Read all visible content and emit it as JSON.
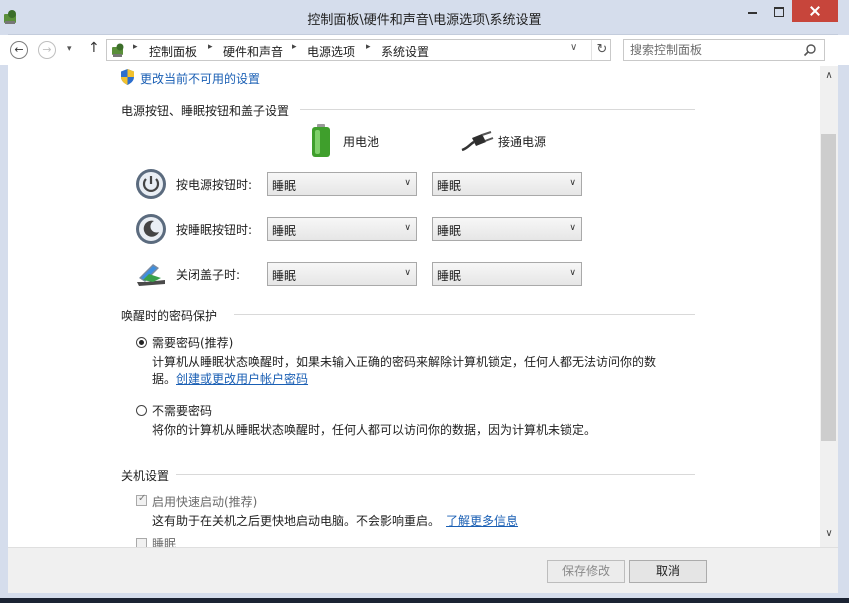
{
  "window": {
    "title": "控制面板\\硬件和声音\\电源选项\\系统设置",
    "minimize_glyph": "",
    "maximize_glyph": "",
    "close_glyph": ""
  },
  "nav": {
    "back_glyph": "←",
    "forward_glyph": "→",
    "history_glyph": "▾",
    "up_glyph": "↑",
    "breadcrumbs": [
      "控制面板",
      "硬件和声音",
      "电源选项",
      "系统设置"
    ],
    "separator_glyph": "▸",
    "dropdown_glyph": "∨",
    "refresh_glyph": "↻",
    "search_placeholder": "搜索控制面板"
  },
  "content": {
    "shield_link": "更改当前不可用的设置",
    "power_section_title": "电源按钮、睡眠按钮和盖子设置",
    "col_battery": "用电池",
    "col_plugged": "接通电源",
    "rows": [
      {
        "label": "按电源按钮时:",
        "battery": "睡眠",
        "plugged": "睡眠"
      },
      {
        "label": "按睡眠按钮时:",
        "battery": "睡眠",
        "plugged": "睡眠"
      },
      {
        "label": "关闭盖子时:",
        "battery": "睡眠",
        "plugged": "睡眠"
      }
    ],
    "select_chevron": "∨",
    "password_section_title": "唤醒时的密码保护",
    "require_password": {
      "label": "需要密码(推荐)",
      "selected": true,
      "desc_line1": "计算机从睡眠状态唤醒时，如果未输入正确的密码来解除计算机锁定，任何人都无法访问你的数",
      "desc_line2_prefix": "据。",
      "desc_link": "创建或更改用户帐户密码"
    },
    "no_password": {
      "label": "不需要密码",
      "selected": false,
      "desc": "将你的计算机从睡眠状态唤醒时，任何人都可以访问你的数据，因为计算机未锁定。"
    },
    "shutdown_section_title": "关机设置",
    "fast_startup": {
      "label": "启用快速启动(推荐)",
      "checked": true,
      "desc_prefix": "这有助于在关机之后更快地启动电脑。不会影响重启。",
      "desc_link": "了解更多信息"
    },
    "partial_next_item": "睡眠"
  },
  "scrollbar": {
    "up_glyph": "∧",
    "down_glyph": "∨"
  },
  "footer": {
    "save_label": "保存修改",
    "cancel_label": "取消"
  },
  "colors": {
    "frame": "#d5ddec",
    "close_button": "#c7453b",
    "link": "#1a5fb4",
    "section_line": "#d9d9d9"
  }
}
